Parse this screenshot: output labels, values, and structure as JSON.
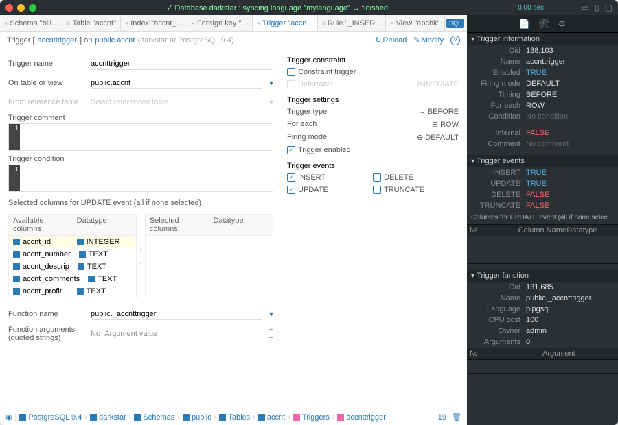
{
  "titlebar": {
    "status": "✓ Database darkstar : syncing language \"mylanguage\" → finished",
    "time": "0.00 sec"
  },
  "tabs": [
    {
      "label": "Schema \"bill...",
      "active": false
    },
    {
      "label": "Table \"accnt\"",
      "active": false
    },
    {
      "label": "Index \"accnt_...",
      "active": false
    },
    {
      "label": "Foreign key \"...",
      "active": false
    },
    {
      "label": "Trigger \"accn...",
      "active": true
    },
    {
      "label": "Rule \"_INSER...",
      "active": false
    },
    {
      "label": "View \"apchk\"",
      "active": false
    }
  ],
  "sql_badge": "SQL",
  "subheader": {
    "prefix": "Trigger [",
    "name": "accnttrigger",
    "mid": "] on",
    "table": "public.accnt",
    "server": "(darkstar at PostgreSQL 9.4)",
    "reload": "Reload",
    "modify": "Modify"
  },
  "form": {
    "trigger_name_label": "Trigger name",
    "trigger_name_value": "accnttrigger",
    "on_table_label": "On table or view",
    "on_table_value": "public.accnt",
    "from_ref_label": "From reference table",
    "from_ref_placeholder": "Select referenced table",
    "comment_label": "Trigger comment",
    "condition_label": "Trigger condition",
    "selected_cols_label": "Selected columns for UPDATE event (all if none selected)",
    "available_hdr": "Available columns",
    "datatype_hdr": "Datatype",
    "selected_hdr": "Selected columns",
    "columns": [
      {
        "name": "accnt_id",
        "type": "INTEGER",
        "selected": true
      },
      {
        "name": "accnt_number",
        "type": "TEXT"
      },
      {
        "name": "accnt_descrip",
        "type": "TEXT"
      },
      {
        "name": "accnt_comments",
        "type": "TEXT"
      },
      {
        "name": "accnt_profit",
        "type": "TEXT"
      }
    ],
    "function_name_label": "Function name",
    "function_name_value": "public._accnttrigger",
    "function_args_label": "Function arguments (quoted strings)",
    "args_no": "No",
    "args_val": "Argument value"
  },
  "settings": {
    "constraint_title": "Trigger constraint",
    "constraint_trigger": "Constraint trigger",
    "deferrable": "Deferrable",
    "immediate": "IMMEDIATE",
    "settings_title": "Trigger settings",
    "type_label": "Trigger type",
    "type_value": "→ BEFORE",
    "foreach_label": "For each",
    "foreach_value": "⊞ ROW",
    "firing_label": "Firing mode",
    "firing_value": "⊕ DEFAULT",
    "enabled_label": "Trigger enabled",
    "events_title": "Trigger events",
    "insert": "INSERT",
    "update": "UPDATE",
    "delete": "DELETE",
    "truncate": "TRUNCATE"
  },
  "breadcrumbs": [
    {
      "label": "PostgreSQL 9.4",
      "color": "#2a7ab8"
    },
    {
      "label": "darkstar",
      "color": "#2a7ab8"
    },
    {
      "label": "Schemas",
      "color": "#2a7ab8"
    },
    {
      "label": "public",
      "color": "#2a7ab8"
    },
    {
      "label": "Tables",
      "color": "#2a7ab8"
    },
    {
      "label": "accnt",
      "color": "#2a7ab8"
    },
    {
      "label": "Triggers",
      "color": "#2a7ab8"
    },
    {
      "label": "accnttrigger",
      "color": "#2a7ab8"
    }
  ],
  "breadcrumb_count": "19",
  "sidebar": {
    "info_title": "Trigger information",
    "info": [
      {
        "k": "Oid",
        "v": "138,103"
      },
      {
        "k": "Name",
        "v": "accnttrigger"
      },
      {
        "k": "Enabled",
        "v": "TRUE",
        "cls": "true"
      },
      {
        "k": "Firing mode",
        "v": "DEFAULT"
      },
      {
        "k": "Timing",
        "v": "BEFORE"
      },
      {
        "k": "For each",
        "v": "ROW"
      },
      {
        "k": "Condition",
        "v": "No condition",
        "cls": "dim"
      },
      {
        "k": "Internal",
        "v": "FALSE",
        "cls": "false"
      },
      {
        "k": "Comment",
        "v": "No comment",
        "cls": "dim"
      }
    ],
    "events_title": "Trigger events",
    "events": [
      {
        "k": "INSERT",
        "v": "TRUE",
        "cls": "true"
      },
      {
        "k": "UPDATE",
        "v": "TRUE",
        "cls": "true"
      },
      {
        "k": "DELETE",
        "v": "FALSE",
        "cls": "false"
      },
      {
        "k": "TRUNCATE",
        "v": "FALSE",
        "cls": "false"
      }
    ],
    "cols_title": "Columns for UPDATE event (all if none selec",
    "cols_hdr_no": "№",
    "cols_hdr_name": "Column Name",
    "cols_hdr_type": "Datatype",
    "func_title": "Trigger function",
    "func": [
      {
        "k": "Oid",
        "v": "131,685"
      },
      {
        "k": "Name",
        "v": "public._accnttrigger"
      },
      {
        "k": "Language",
        "v": "plpgsql"
      },
      {
        "k": "CPU cost",
        "v": "100"
      },
      {
        "k": "Owner",
        "v": "admin"
      },
      {
        "k": "Arguments",
        "v": "0"
      }
    ],
    "arg_hdr_no": "№",
    "arg_hdr_name": "Argument"
  }
}
